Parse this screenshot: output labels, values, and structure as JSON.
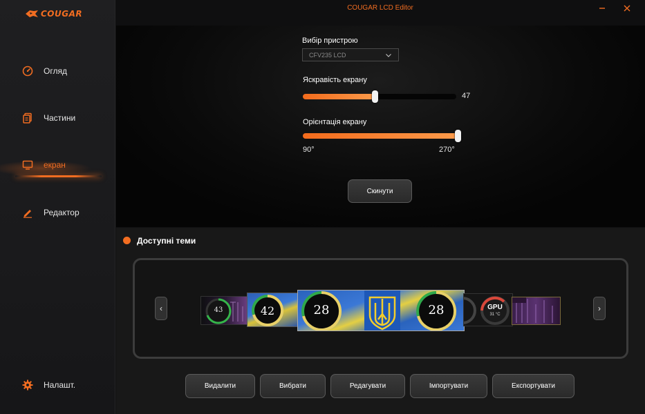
{
  "titlebar": {
    "title": "COUGAR LCD Editor"
  },
  "brand": {
    "logo_text": "COUGAR",
    "accent": "#f26d21"
  },
  "sidebar": {
    "items": [
      {
        "label": "Огляд",
        "icon": "speedometer-icon"
      },
      {
        "label": "Частини",
        "icon": "parts-icon"
      },
      {
        "label": "екран",
        "icon": "monitor-icon",
        "active": true
      },
      {
        "label": "Редактор",
        "icon": "pen-icon"
      }
    ],
    "settings": {
      "label": "Налашт.",
      "icon": "gear-icon"
    }
  },
  "device": {
    "label": "Вибір пристрою",
    "value": "CFV235 LCD"
  },
  "brightness": {
    "label": "Яскравість екрану",
    "value": "47",
    "fraction": 0.47
  },
  "orientation": {
    "label": "Орієнтація екрану",
    "min_label": "90°",
    "max_label": "270°",
    "fraction": 1.0
  },
  "reset_label": "Скинути",
  "themes": {
    "title": "Доступні теми",
    "thumbnails": [
      {
        "number": "43"
      },
      {
        "number": "42"
      },
      {
        "number": "28"
      },
      {
        "number": "28"
      },
      {
        "text": "GPU",
        "sub": "31 °C"
      }
    ]
  },
  "actions": {
    "delete": "Видалити",
    "select": "Вибрати",
    "edit": "Редагувати",
    "import": "Імпортувати",
    "export": "Експортувати"
  }
}
